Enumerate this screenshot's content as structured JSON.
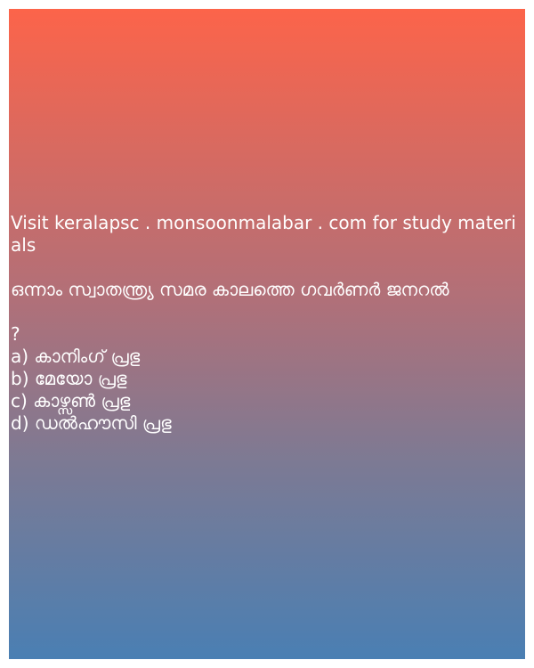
{
  "header": {
    "visit_line": "Visit keralapsc . monsoonmalabar . com for study materials"
  },
  "question": {
    "text": " ഒന്നാം സ്വാതന്ത്ര്യ സമര കാലത്തെ ഗവർണർ ജനറൽ",
    "mark": "?"
  },
  "options": [
    "a) കാനിംഗ് പ്രഭു",
    "b) മേയോ പ്രഭു",
    "c) കാഴ്സൺ  പ്രഭു",
    "d) ഡൽഹൗസി പ്രഭു"
  ]
}
